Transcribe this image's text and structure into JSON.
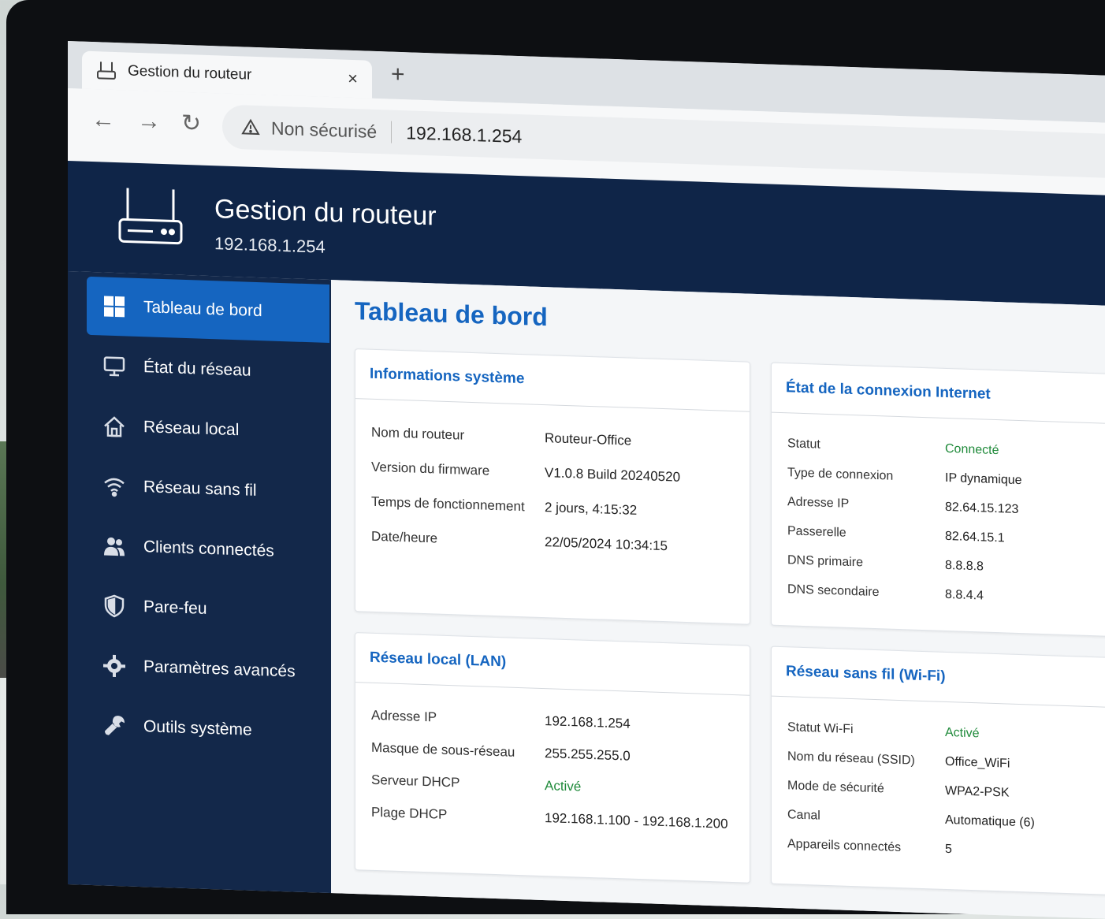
{
  "browser": {
    "tab_title": "Gestion du routeur",
    "close_symbol": "×",
    "new_tab_symbol": "+",
    "back_symbol": "←",
    "forward_symbol": "→",
    "reload_symbol": "↻",
    "security_label": "Non sécurisé",
    "url": "192.168.1.254"
  },
  "header": {
    "title": "Gestion du routeur",
    "ip": "192.168.1.254"
  },
  "sidebar": {
    "items": [
      {
        "label": "Tableau de bord",
        "icon": "grid-icon",
        "active": true
      },
      {
        "label": "État du réseau",
        "icon": "monitor-icon"
      },
      {
        "label": "Réseau local",
        "icon": "home-icon"
      },
      {
        "label": "Réseau sans fil",
        "icon": "wifi-icon"
      },
      {
        "label": "Clients connectés",
        "icon": "users-icon"
      },
      {
        "label": "Pare-feu",
        "icon": "shield-icon"
      },
      {
        "label": "Paramètres avancés",
        "icon": "gear-icon"
      },
      {
        "label": "Outils système",
        "icon": "wrench-icon"
      }
    ]
  },
  "main": {
    "title": "Tableau de bord",
    "system_info": {
      "title": "Informations système",
      "rows": [
        {
          "key": "Nom du routeur",
          "value": "Routeur-Office"
        },
        {
          "key": "Version du firmware",
          "value": "V1.0.8 Build 20240520"
        },
        {
          "key": "Temps de fonctionnement",
          "value": "2 jours, 4:15:32"
        },
        {
          "key": "Date/heure",
          "value": "22/05/2024 10:34:15"
        }
      ]
    },
    "internet": {
      "title": "État de la connexion Internet",
      "rows": [
        {
          "key": "Statut",
          "value": "Connecté"
        },
        {
          "key": "Type de connexion",
          "value": "IP dynamique"
        },
        {
          "key": "Adresse IP",
          "value": "82.64.15.123"
        },
        {
          "key": "Passerelle",
          "value": "82.64.15.1"
        },
        {
          "key": "DNS primaire",
          "value": "8.8.8.8"
        },
        {
          "key": "DNS secondaire",
          "value": "8.8.4.4"
        }
      ]
    },
    "lan": {
      "title": "Réseau local (LAN)",
      "rows": [
        {
          "key": "Adresse IP",
          "value": "192.168.1.254"
        },
        {
          "key": "Masque de sous-réseau",
          "value": "255.255.255.0"
        },
        {
          "key": "Serveur DHCP",
          "value": "Activé"
        },
        {
          "key": "Plage DHCP",
          "value": "192.168.1.100 - 192.168.1.200"
        }
      ]
    },
    "wifi": {
      "title": "Réseau sans fil (Wi-Fi)",
      "rows": [
        {
          "key": "Statut Wi-Fi",
          "value": "Activé"
        },
        {
          "key": "Nom du réseau (SSID)",
          "value": "Office_WiFi"
        },
        {
          "key": "Mode de sécurité",
          "value": "WPA2-PSK"
        },
        {
          "key": "Canal",
          "value": "Automatique (6)"
        },
        {
          "key": "Appareils connectés",
          "value": "5"
        }
      ]
    }
  },
  "colors": {
    "accent": "#1565c0",
    "header_bg": "#0f2548",
    "sidebar_bg": "#13284a",
    "status_green": "#1f8a3a"
  }
}
